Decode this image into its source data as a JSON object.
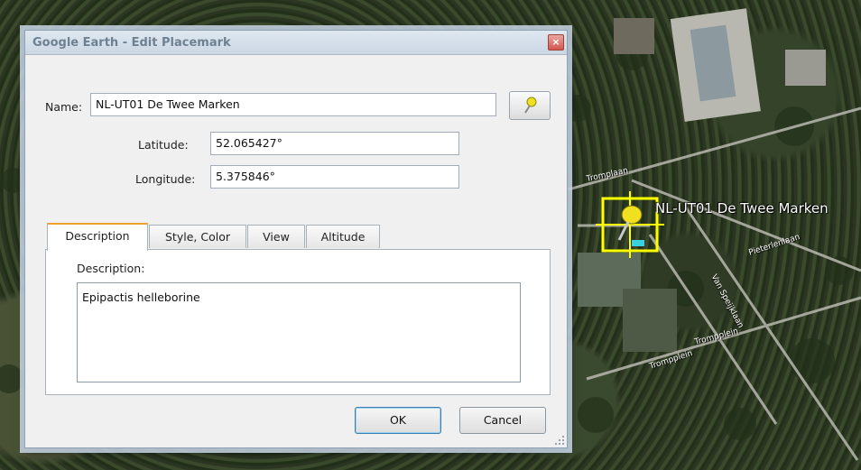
{
  "dialog": {
    "title": "Google Earth - Edit Placemark",
    "close_glyph": "×",
    "name_label": "Name:",
    "name_value": "NL-UT01 De Twee Marken",
    "pin_icon": "yellow-pushpin-icon",
    "latitude_label": "Latitude:",
    "latitude_value": "52.065427°",
    "longitude_label": "Longitude:",
    "longitude_value": "5.375846°",
    "tabs": [
      {
        "label": "Description",
        "active": true
      },
      {
        "label": "Style, Color",
        "active": false
      },
      {
        "label": "View",
        "active": false
      },
      {
        "label": "Altitude",
        "active": false
      }
    ],
    "description_label": "Description:",
    "description_value": "Epipactis helleborine",
    "ok_label": "OK",
    "cancel_label": "Cancel"
  },
  "map": {
    "placemark_label": "NL-UT01 De Twee Marken",
    "road_labels": [
      "Tromplaan",
      "Pieterlenlaan",
      "Van Speijklaan",
      "Trompplein",
      "Trompplein"
    ]
  },
  "colors": {
    "active_tab_accent": "#f0a030",
    "placemark_box": "#ffff00",
    "pushpin": "#f0e020"
  }
}
